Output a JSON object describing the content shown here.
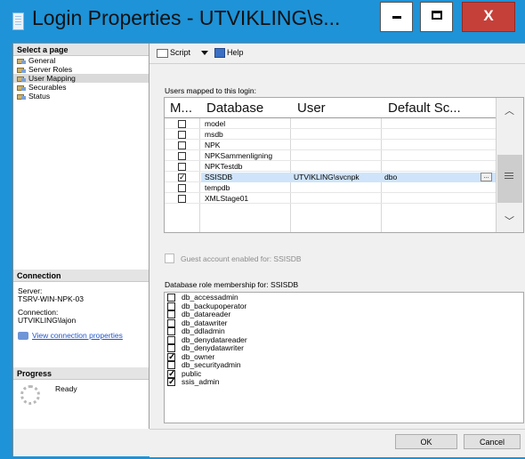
{
  "window": {
    "title": "Login Properties - UTVIKLING\\s...",
    "close_glyph": "X"
  },
  "sidebar": {
    "header": "Select a page",
    "items": [
      {
        "label": "General",
        "selected": false
      },
      {
        "label": "Server Roles",
        "selected": false
      },
      {
        "label": "User Mapping",
        "selected": true
      },
      {
        "label": "Securables",
        "selected": false
      },
      {
        "label": "Status",
        "selected": false
      }
    ]
  },
  "connection": {
    "header": "Connection",
    "server_label": "Server:",
    "server_value": "TSRV-WIN-NPK-03",
    "connection_label": "Connection:",
    "connection_value": "UTVIKLING\\lajon",
    "view_link": "View connection properties"
  },
  "progress": {
    "header": "Progress",
    "status": "Ready"
  },
  "toolbar": {
    "script_label": "Script",
    "help_label": "Help"
  },
  "mapping": {
    "caption": "Users mapped to this login:",
    "columns": [
      "M...",
      "Database",
      "User",
      "Default Sc..."
    ],
    "rows": [
      {
        "map": false,
        "database": "model",
        "user": "",
        "schema": "",
        "selected": false
      },
      {
        "map": false,
        "database": "msdb",
        "user": "",
        "schema": "",
        "selected": false
      },
      {
        "map": false,
        "database": "NPK",
        "user": "",
        "schema": "",
        "selected": false
      },
      {
        "map": false,
        "database": "NPKSammenligning",
        "user": "",
        "schema": "",
        "selected": false
      },
      {
        "map": false,
        "database": "NPKTestdb",
        "user": "",
        "schema": "",
        "selected": false
      },
      {
        "map": true,
        "database": "SSISDB",
        "user": "UTVIKLING\\svcnpk",
        "schema": "dbo",
        "selected": true,
        "ellipsis": "..."
      },
      {
        "map": false,
        "database": "tempdb",
        "user": "",
        "schema": "",
        "selected": false
      },
      {
        "map": false,
        "database": "XMLStage01",
        "user": "",
        "schema": "",
        "selected": false
      }
    ]
  },
  "guest": {
    "label": "Guest account enabled for: SSISDB",
    "checked": false,
    "enabled": false
  },
  "roles": {
    "caption": "Database role membership for: SSISDB",
    "items": [
      {
        "label": "db_accessadmin",
        "checked": false
      },
      {
        "label": "db_backupoperator",
        "checked": false
      },
      {
        "label": "db_datareader",
        "checked": false
      },
      {
        "label": "db_datawriter",
        "checked": false
      },
      {
        "label": "db_ddladmin",
        "checked": false
      },
      {
        "label": "db_denydatareader",
        "checked": false
      },
      {
        "label": "db_denydatawriter",
        "checked": false
      },
      {
        "label": "db_owner",
        "checked": true
      },
      {
        "label": "db_securityadmin",
        "checked": false
      },
      {
        "label": "public",
        "checked": true
      },
      {
        "label": "ssis_admin",
        "checked": true
      }
    ]
  },
  "buttons": {
    "ok": "OK",
    "cancel": "Cancel"
  },
  "colors": {
    "titlebar": "#1e93d8",
    "close_button": "#c6403a",
    "selection": "#cfe4fa",
    "link": "#2055cc"
  },
  "icons": [
    "app-icon",
    "minimize-icon",
    "maximize-icon",
    "close-icon",
    "page-icon",
    "script-icon",
    "dropdown-arrow-icon",
    "help-icon",
    "connection-icon",
    "progress-spinner-icon",
    "scroll-up-icon",
    "scroll-down-icon"
  ]
}
